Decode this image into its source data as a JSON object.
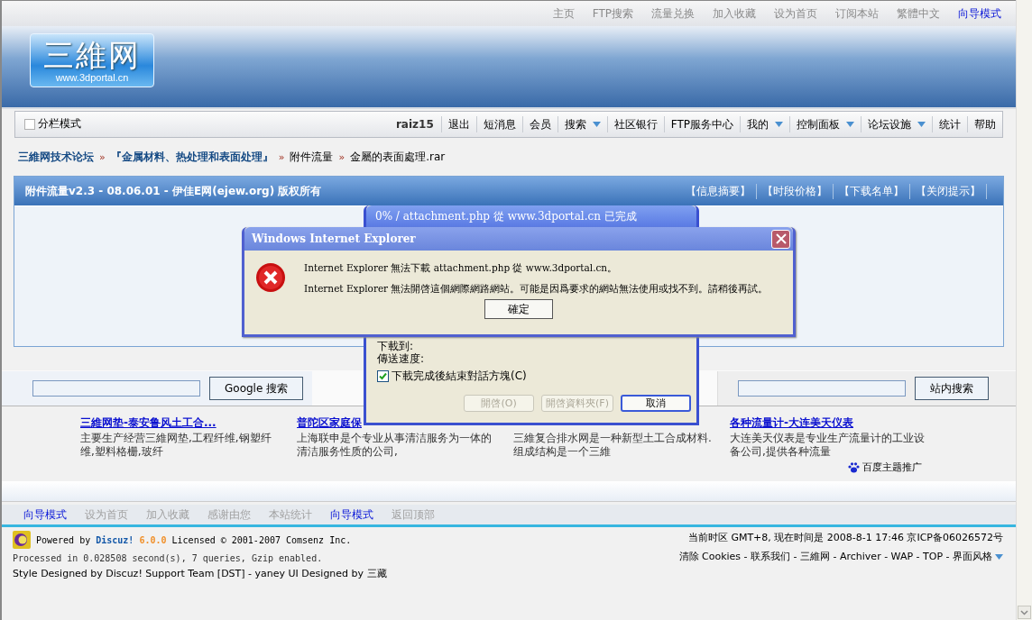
{
  "top_links": [
    {
      "label": "主页",
      "selected": false
    },
    {
      "label": "FTP搜索",
      "selected": false
    },
    {
      "label": "流量兑换",
      "selected": false
    },
    {
      "label": "加入收藏",
      "selected": false
    },
    {
      "label": "设为首页",
      "selected": false
    },
    {
      "label": "订阅本站",
      "selected": false
    },
    {
      "label": "繁體中文",
      "selected": false
    },
    {
      "label": "向导模式",
      "selected": true
    }
  ],
  "logo": {
    "title": "三維网",
    "url": "www.3dportal.cn"
  },
  "layout_toggle": {
    "label": "分栏模式",
    "checked": false
  },
  "nav": {
    "user": "raiz15",
    "items": [
      {
        "label": "退出",
        "dropdown": false
      },
      {
        "label": "短消息",
        "dropdown": false
      },
      {
        "label": "会员",
        "dropdown": false
      },
      {
        "label": "搜索",
        "dropdown": true
      },
      {
        "label": "社区银行",
        "dropdown": false
      },
      {
        "label": "FTP服务中心",
        "dropdown": false
      },
      {
        "label": "我的",
        "dropdown": true
      },
      {
        "label": "控制面板",
        "dropdown": true
      },
      {
        "label": "论坛设施",
        "dropdown": true
      },
      {
        "label": "统计",
        "dropdown": false
      },
      {
        "label": "帮助",
        "dropdown": false
      }
    ]
  },
  "breadcrumb": [
    {
      "label": "三維网技术论坛",
      "kind": "link"
    },
    {
      "prefix": "»",
      "label": "『金属材料、热处理和表面处理』",
      "kind": "link"
    },
    {
      "prefix": "»",
      "label": "附件流量",
      "kind": "text"
    },
    {
      "prefix": "»",
      "label": "金屬的表面處理.rar",
      "kind": "text"
    }
  ],
  "panel": {
    "title": "附件流量v2.3 - 08.06.01 - 伊佳E网(ejew.org) 版权所有",
    "links": [
      "【信息摘要】",
      "【时段价格】",
      "【下载名单】",
      "【关闭提示】"
    ]
  },
  "search": {
    "google_button": "Google 搜索",
    "site_button": "站内搜索"
  },
  "ads": [
    {
      "title": "三維网垫-泰安鲁风土工合...",
      "description": "主要生产经营三維网垫,工程纤维,钢塑纤维,塑料格栅,玻纤"
    },
    {
      "title": "普陀区家庭保",
      "description": "上海联申是个专业从事清洁服务为一体的清洁服务性质的公司,"
    },
    {
      "description": "三維复合排水网是一种新型土工合成材料.组成结构是一个三維"
    },
    {
      "title": "各种流量计-大连美天仪表",
      "description": "大连美天仪表是专业生产流量计的工业设备公司,提供各种流量"
    }
  ],
  "sponsor": "百度主题推广",
  "footer_links": [
    {
      "label": "向导模式",
      "selected": true
    },
    {
      "label": "设为首页",
      "selected": false
    },
    {
      "label": "加入收藏",
      "selected": false
    },
    {
      "label": "感谢由您",
      "selected": false
    },
    {
      "label": "本站统计",
      "selected": false
    },
    {
      "label": "向导模式",
      "selected": true
    },
    {
      "label": "返回顶部",
      "selected": false
    }
  ],
  "footer": {
    "powered": "Powered by **Discuz!** **6.0.0** Licensed © 2001-2007 Comsenz Inc.",
    "processed": "Processed in 0.028508 second(s), 7 queries, Gzip enabled.",
    "credit": "Style Designed by Discuz! Support Team [DST] - yaney UI Designed by 三藏",
    "timezone": "当前时区  GMT+8, 现在时间是  2008-8-1 17:46 京ICP备06026572号",
    "links": "清除  Cookies - 联系我们  - 三維网  - Archiver - WAP - TOP - 界面风格"
  },
  "download_dialog": {
    "title": "0% / attachment.php 從 www.3dportal.cn 已完成",
    "save_to": "下載到:",
    "speed": "傳送速度:",
    "close_when_done": {
      "label": "下載完成後結束對話方塊(C)",
      "checked": true
    },
    "buttons": [
      {
        "label": "開啓(O)",
        "disabled": true
      },
      {
        "label": "開啓資料夾(F)",
        "disabled": true
      },
      {
        "label": "取消",
        "disabled": false
      }
    ]
  },
  "error_dialog": {
    "title": "Windows Internet Explorer",
    "messages": [
      "Internet Explorer 無法下載 attachment.php 從 www.3dportal.cn。",
      "Internet Explorer 無法開啓這個網際網路網站。可能是因爲要求的網站無法使用或找不到。請稍後再試。"
    ],
    "button": "確定"
  }
}
